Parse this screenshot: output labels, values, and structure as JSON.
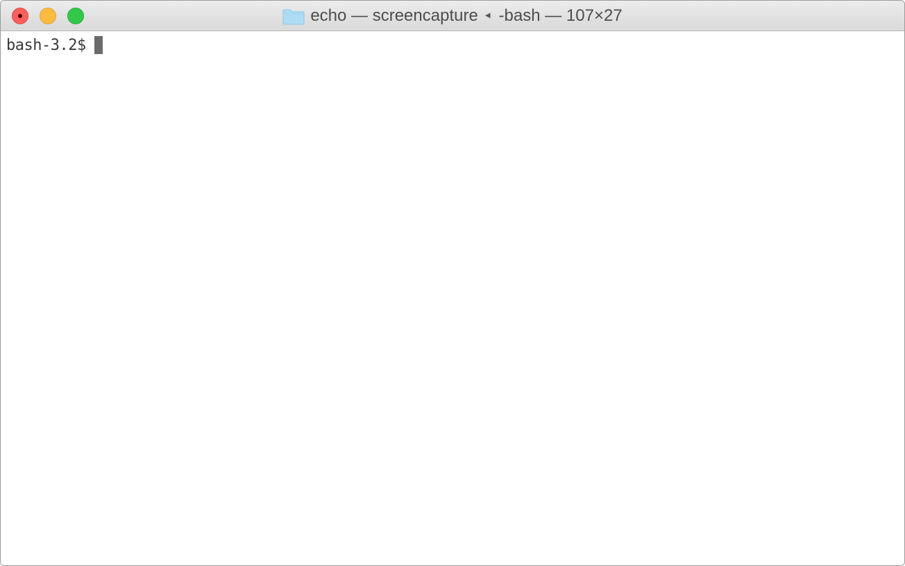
{
  "window": {
    "title": {
      "folder_name": "echo",
      "sep1": "—",
      "process": "screencapture",
      "shell": "-bash",
      "sep2": "—",
      "size": "107×27"
    },
    "icons": {
      "folder": "folder-icon",
      "arrow": "left-arrow-icon"
    },
    "colors": {
      "close": "#fc605c",
      "minimize": "#fdbc40",
      "zoom": "#34c84a",
      "folder": "#aedcf5"
    }
  },
  "terminal": {
    "prompt": "bash-3.2$"
  }
}
